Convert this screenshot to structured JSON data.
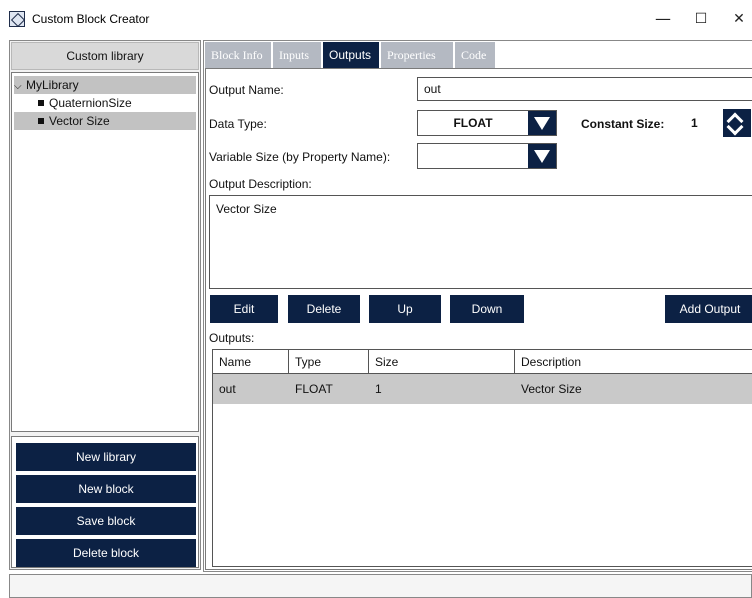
{
  "window": {
    "title": "Custom Block Creator",
    "controls": {
      "minimize": "—",
      "maximize": "☐",
      "close": "✕"
    }
  },
  "left": {
    "header": "Custom library",
    "tree": [
      {
        "label": "MyLibrary",
        "kind": "library",
        "expanded": true
      },
      {
        "label": "QuaternionSize",
        "kind": "block"
      },
      {
        "label": "Vector Size",
        "kind": "block",
        "selected": true
      }
    ],
    "buttons": [
      "New library",
      "New block",
      "Save block",
      "Delete block"
    ]
  },
  "tabs": [
    {
      "label": "Block Info"
    },
    {
      "label": "Inputs"
    },
    {
      "label": "Outputs",
      "active": true
    },
    {
      "label": "Properties"
    },
    {
      "label": "Code"
    }
  ],
  "form": {
    "output_name_label": "Output Name:",
    "output_name_value": "out",
    "data_type_label": "Data Type:",
    "data_type_value": "FLOAT",
    "constant_size_label": "Constant Size:",
    "constant_size_value": "1",
    "variable_size_label": "Variable Size (by Property Name):",
    "variable_size_value": "",
    "output_description_label": "Output Description:",
    "output_description_value": "Vector Size"
  },
  "actions": {
    "edit": "Edit",
    "delete": "Delete",
    "up": "Up",
    "down": "Down",
    "add_output": "Add Output"
  },
  "outputs": {
    "label": "Outputs:",
    "columns": [
      "Name",
      "Type",
      "Size",
      "Description"
    ],
    "rows": [
      {
        "name": "out",
        "type": "FLOAT",
        "size": "1",
        "description": "Vector Size"
      }
    ]
  },
  "colors": {
    "accent": "#0c2144",
    "selection": "#c2c2c2",
    "inactive_tab": "#b4b9c2"
  }
}
